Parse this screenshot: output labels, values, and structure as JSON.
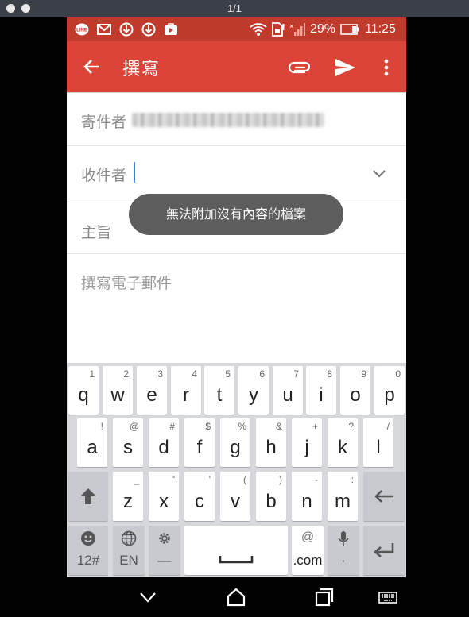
{
  "window": {
    "title": "1/1"
  },
  "statusbar": {
    "icons": [
      "line-icon",
      "gmail-icon",
      "download-icon",
      "download-icon",
      "play-store-icon"
    ],
    "battery_percent": "29%",
    "time": "11:25"
  },
  "appbar": {
    "title": "撰寫"
  },
  "compose": {
    "from_label": "寄件者",
    "to_label": "收件者",
    "subject_label": "主旨",
    "body_placeholder": "撰寫電子郵件"
  },
  "toast": {
    "message": "無法附加沒有內容的檔案"
  },
  "keyboard": {
    "row1": [
      {
        "key": "q",
        "hint": "1"
      },
      {
        "key": "w",
        "hint": "2"
      },
      {
        "key": "e",
        "hint": "3"
      },
      {
        "key": "r",
        "hint": "4"
      },
      {
        "key": "t",
        "hint": "5"
      },
      {
        "key": "y",
        "hint": "6"
      },
      {
        "key": "u",
        "hint": "7"
      },
      {
        "key": "i",
        "hint": "8"
      },
      {
        "key": "o",
        "hint": "9"
      },
      {
        "key": "p",
        "hint": "0"
      }
    ],
    "row2": [
      {
        "key": "a",
        "hint": "!"
      },
      {
        "key": "s",
        "hint": "@"
      },
      {
        "key": "d",
        "hint": "#"
      },
      {
        "key": "f",
        "hint": "$"
      },
      {
        "key": "g",
        "hint": "%"
      },
      {
        "key": "h",
        "hint": "&"
      },
      {
        "key": "j",
        "hint": "+"
      },
      {
        "key": "k",
        "hint": "?"
      },
      {
        "key": "l",
        "hint": "/"
      }
    ],
    "row3": [
      {
        "key": "z",
        "hint": "_"
      },
      {
        "key": "x",
        "hint": "\""
      },
      {
        "key": "c",
        "hint": "'"
      },
      {
        "key": "v",
        "hint": "("
      },
      {
        "key": "b",
        "hint": ")"
      },
      {
        "key": "n",
        "hint": "-"
      },
      {
        "key": "m",
        "hint": ":"
      }
    ],
    "symbols_label": "12#",
    "language_label": "EN",
    "settings_label": "—",
    "at_label": "@",
    "dotcom_label": ".com",
    "mic_label": "·"
  }
}
